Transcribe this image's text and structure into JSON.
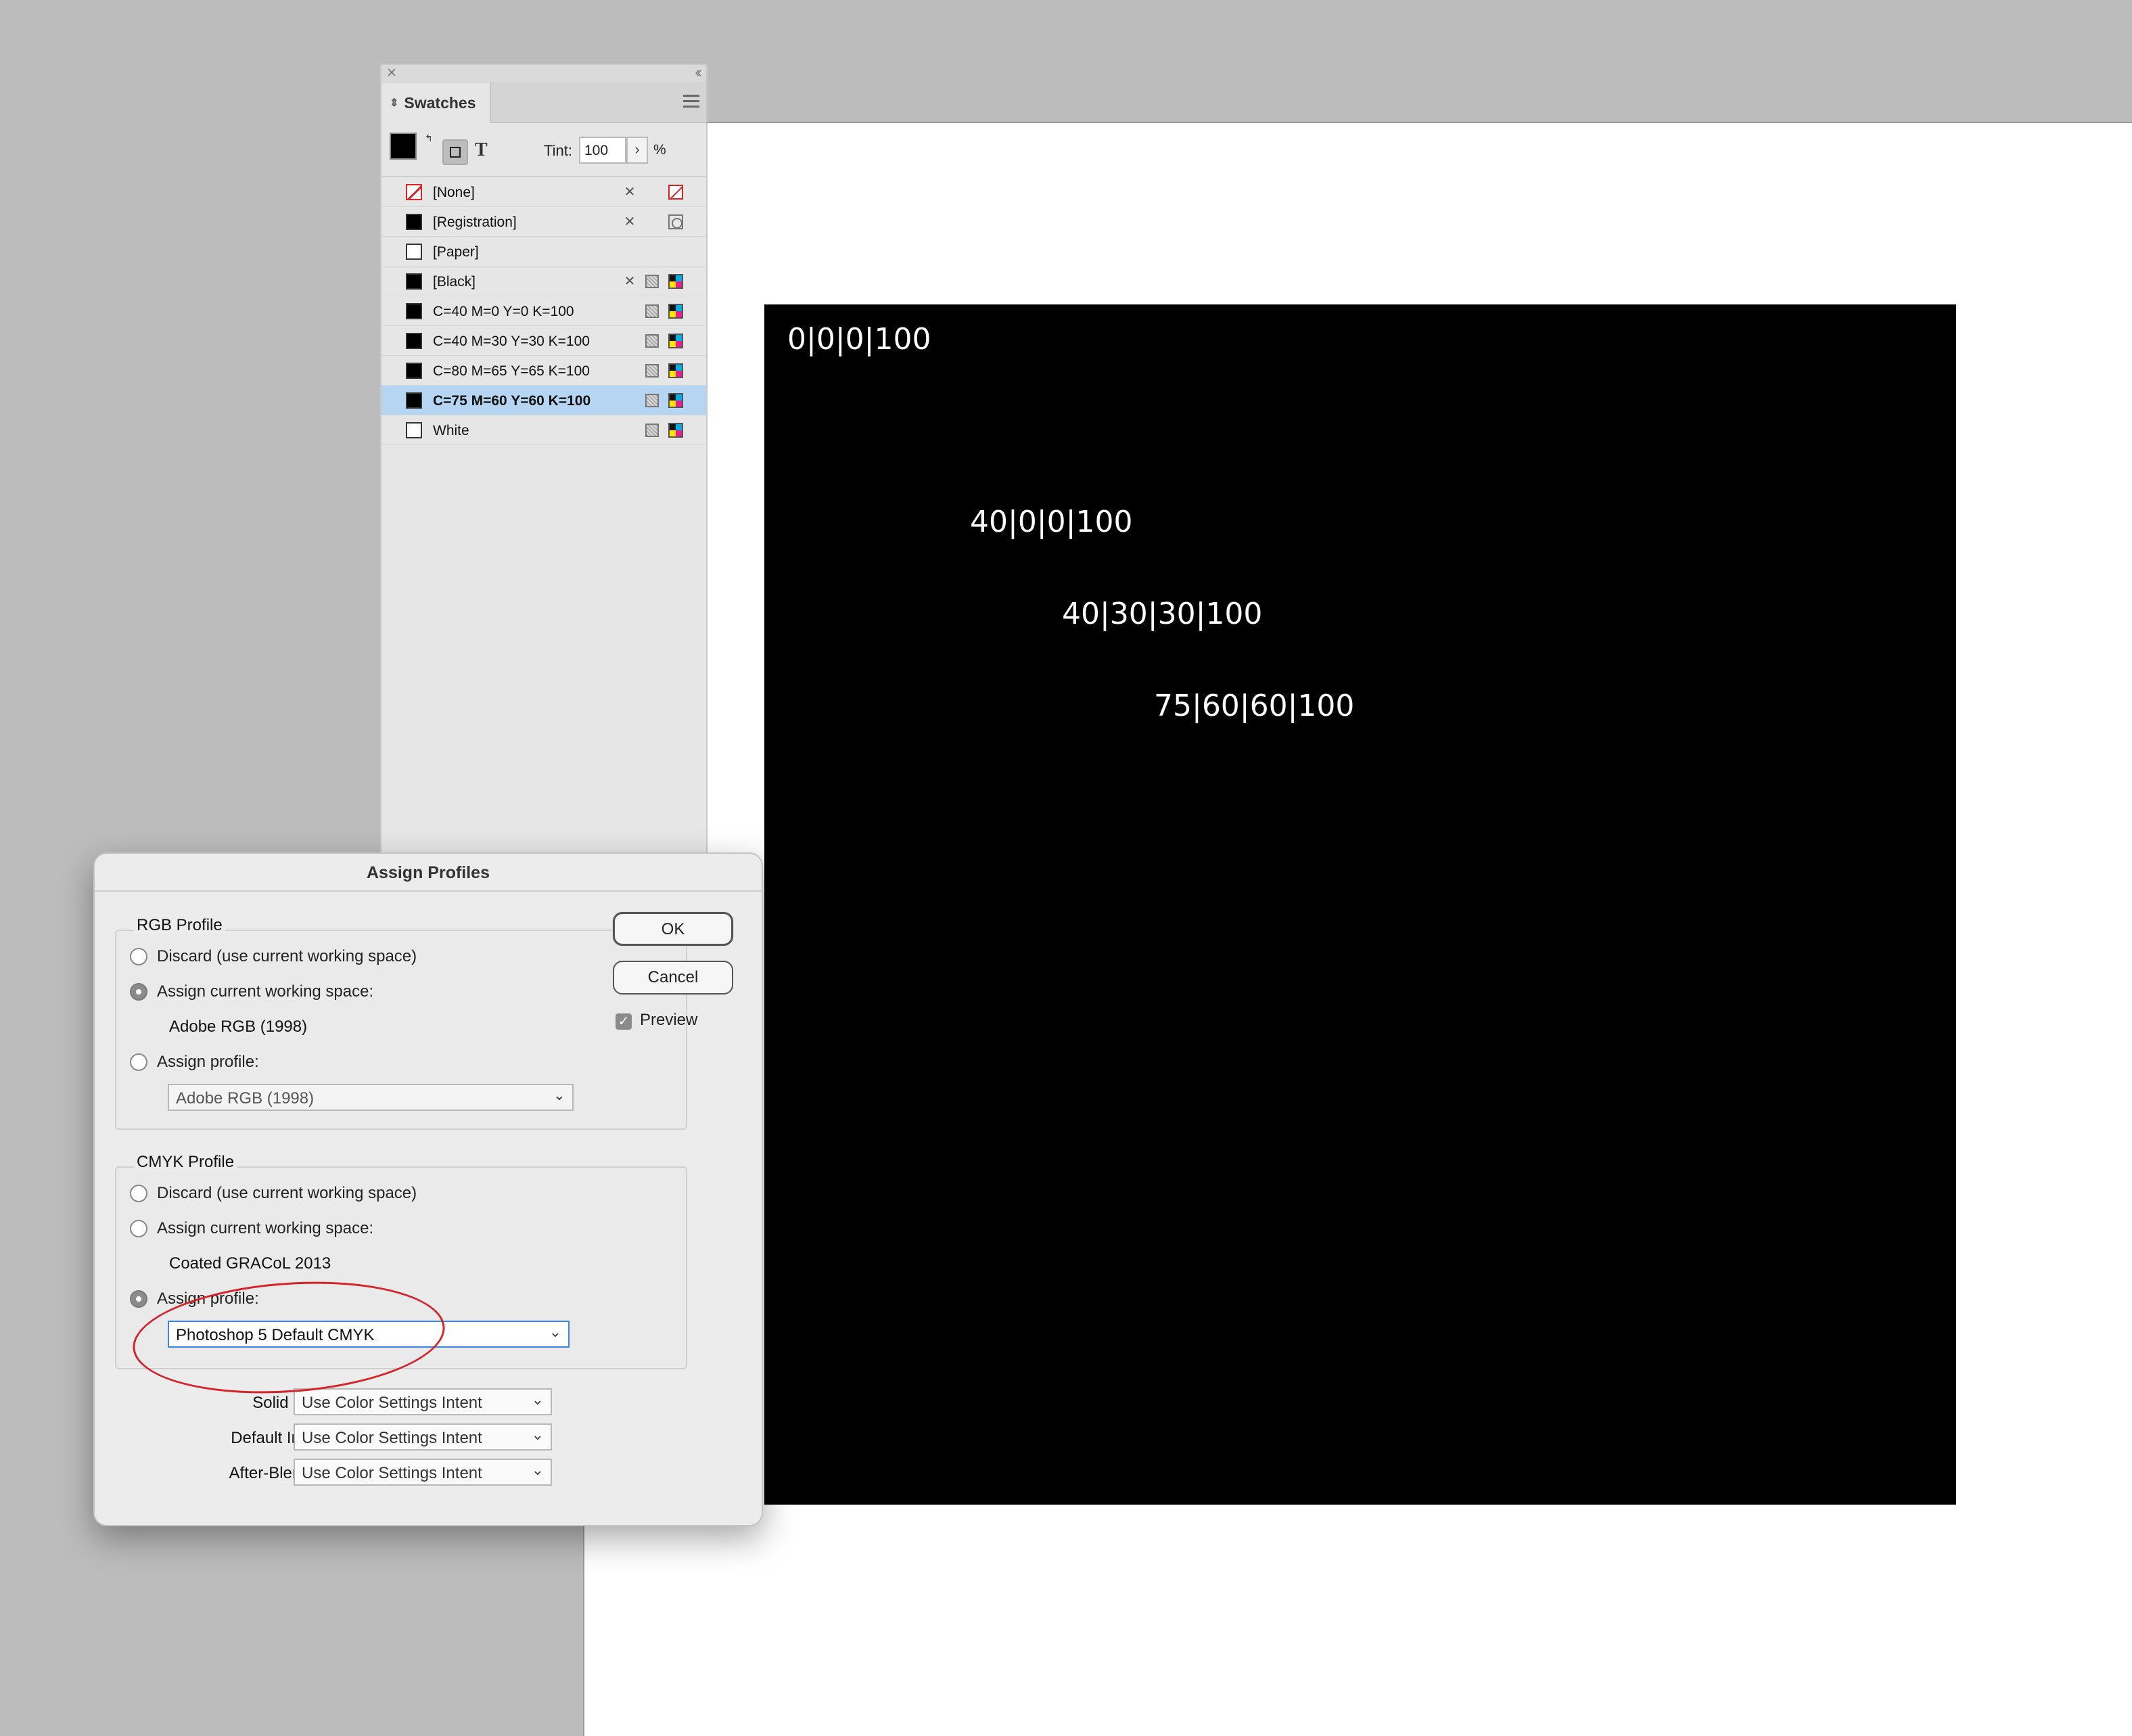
{
  "document": {
    "labels": [
      "0|0|0|100",
      "40|0|0|100",
      "40|30|30|100",
      "75|60|60|100"
    ]
  },
  "swatches_panel": {
    "tab_label": "Swatches",
    "tint_label": "Tint:",
    "tint_value": "100",
    "tint_unit": "%",
    "text_button": "T",
    "items": [
      {
        "name": "[None]"
      },
      {
        "name": "[Registration]"
      },
      {
        "name": "[Paper]"
      },
      {
        "name": "[Black]"
      },
      {
        "name": "C=40 M=0 Y=0 K=100"
      },
      {
        "name": "C=40 M=30 Y=30 K=100"
      },
      {
        "name": "C=80 M=65 Y=65 K=100"
      },
      {
        "name": "C=75 M=60 Y=60 K=100"
      },
      {
        "name": "White"
      }
    ]
  },
  "dialog": {
    "title": "Assign Profiles",
    "rgb": {
      "title": "RGB Profile",
      "discard": "Discard (use current working space)",
      "assign_current": "Assign current working space:",
      "working_space": "Adobe RGB (1998)",
      "assign_profile": "Assign profile:",
      "profile_select": "Adobe RGB (1998)"
    },
    "cmyk": {
      "title": "CMYK Profile",
      "discard": "Discard (use current working space)",
      "assign_current": "Assign current working space:",
      "working_space": "Coated GRACoL 2013",
      "assign_profile": "Assign profile:",
      "profile_select": "Photoshop 5 Default CMYK"
    },
    "intents": {
      "solid_label": "Solid Color Intent:",
      "solid_value": "Use Color Settings Intent",
      "image_label": "Default Image Intent:",
      "image_value": "Use Color Settings Intent",
      "blend_label": "After-Blending Intent:",
      "blend_value": "Use Color Settings Intent"
    },
    "ok": "OK",
    "cancel": "Cancel",
    "preview": "Preview"
  }
}
